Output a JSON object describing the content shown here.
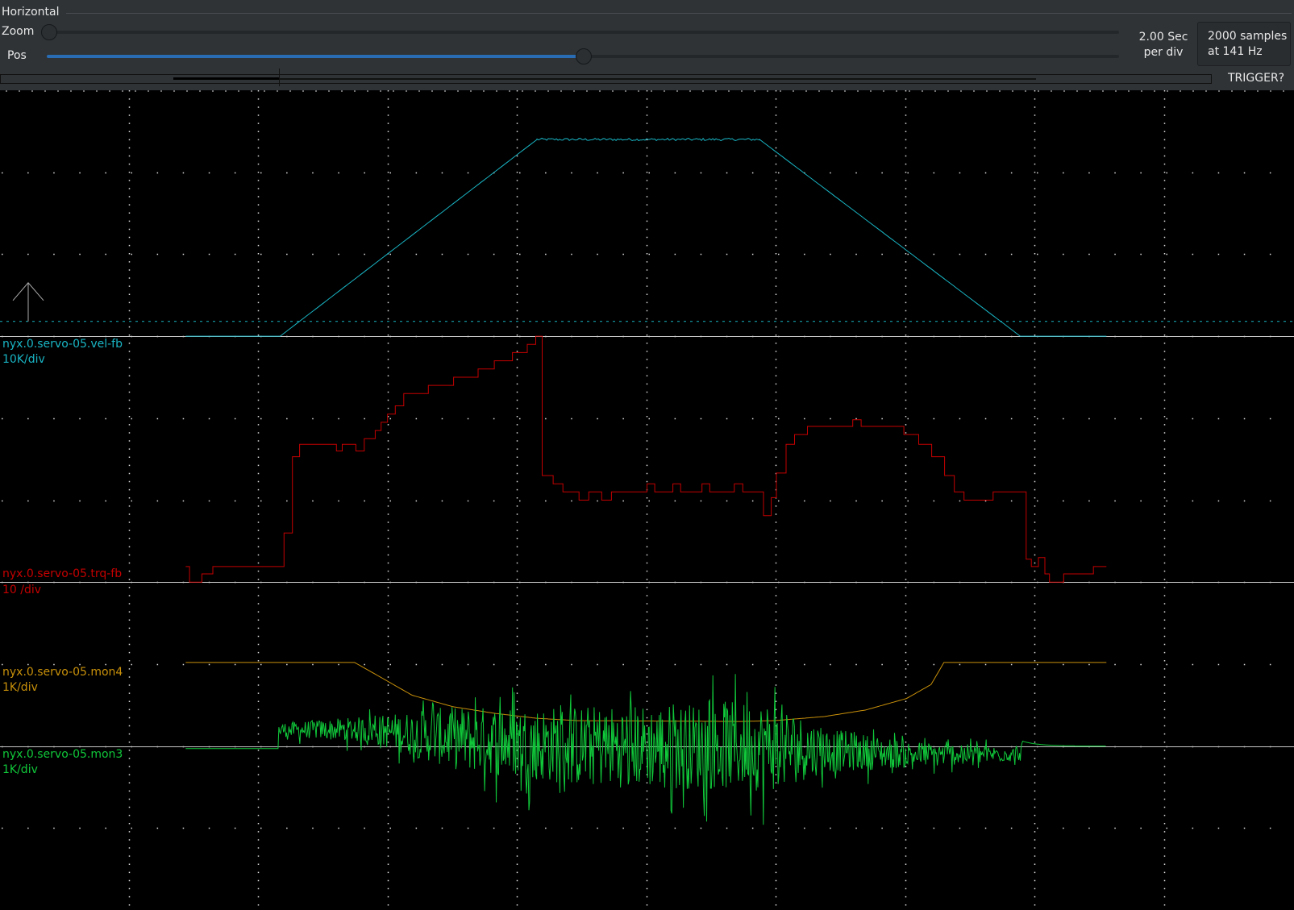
{
  "header": {
    "section_label": "Horizontal",
    "zoom_label": "Zoom",
    "pos_label": "Pos",
    "zoom_value": 0,
    "pos_value": 0.5,
    "timebase_line1": "2.00 Sec",
    "timebase_line2": "per div",
    "samples_line1": "2000 samples",
    "samples_line2": "at 141 Hz",
    "trigger_status": "TRIGGER?"
  },
  "chart_data": {
    "type": "line",
    "xlim": [
      0,
      20
    ],
    "x_units": "s",
    "divisions": {
      "x": 10,
      "y": 10
    },
    "grid": true,
    "trigger": {
      "channel": "nyx.0.servo-05.vel-fb",
      "level": 1800,
      "direction": "rising"
    },
    "series": [
      {
        "name": "nyx.0.servo-05.vel-fb",
        "scale_label": "10K/div",
        "per_div": 10000,
        "baseline_div": 3,
        "color": "#19b5c4",
        "step": false,
        "jitter": 150,
        "points": [
          [
            2.87,
            0
          ],
          [
            4.33,
            0
          ],
          [
            8.3,
            24000
          ],
          [
            11.74,
            24000
          ],
          [
            15.77,
            0
          ],
          [
            17.1,
            0
          ]
        ]
      },
      {
        "name": "nyx.0.servo-05.trq-fb",
        "scale_label": "10 /div",
        "per_div": 10,
        "baseline_div": 6,
        "color": "#c40000",
        "step": true,
        "points": [
          [
            2.87,
            1.9
          ],
          [
            2.93,
            0
          ],
          [
            3.12,
            1.0
          ],
          [
            3.29,
            1.9
          ],
          [
            4.39,
            6.0
          ],
          [
            4.52,
            15.3
          ],
          [
            4.63,
            16.8
          ],
          [
            5.2,
            16.0
          ],
          [
            5.29,
            16.8
          ],
          [
            5.5,
            16.0
          ],
          [
            5.63,
            17.5
          ],
          [
            5.8,
            18.5
          ],
          [
            5.89,
            19.5
          ],
          [
            5.99,
            20.5
          ],
          [
            6.11,
            21.5
          ],
          [
            6.24,
            23.0
          ],
          [
            6.62,
            24.0
          ],
          [
            7.01,
            25.0
          ],
          [
            7.39,
            26.0
          ],
          [
            7.64,
            27.0
          ],
          [
            7.92,
            28.0
          ],
          [
            8.15,
            29.0
          ],
          [
            8.28,
            30.0
          ],
          [
            8.38,
            13.0
          ],
          [
            8.55,
            12.0
          ],
          [
            8.7,
            11.0
          ],
          [
            8.95,
            10.0
          ],
          [
            9.1,
            11.0
          ],
          [
            9.3,
            10.0
          ],
          [
            9.45,
            11.0
          ],
          [
            10.0,
            12.0
          ],
          [
            10.12,
            11.0
          ],
          [
            10.4,
            12.0
          ],
          [
            10.52,
            11.0
          ],
          [
            10.85,
            12.0
          ],
          [
            10.97,
            11.0
          ],
          [
            11.35,
            12.0
          ],
          [
            11.48,
            11.0
          ],
          [
            11.8,
            8.1
          ],
          [
            11.92,
            10.3
          ],
          [
            12.0,
            13.3
          ],
          [
            12.15,
            16.8
          ],
          [
            12.28,
            18.0
          ],
          [
            12.48,
            19.0
          ],
          [
            13.18,
            19.8
          ],
          [
            13.31,
            19.0
          ],
          [
            13.97,
            18.0
          ],
          [
            14.2,
            16.8
          ],
          [
            14.4,
            15.3
          ],
          [
            14.6,
            13.0
          ],
          [
            14.75,
            11.0
          ],
          [
            14.9,
            10.0
          ],
          [
            15.35,
            11.0
          ],
          [
            15.86,
            2.8
          ],
          [
            15.94,
            1.9
          ],
          [
            16.05,
            3.0
          ],
          [
            16.15,
            1.0
          ],
          [
            16.22,
            0
          ],
          [
            16.44,
            1.0
          ],
          [
            16.9,
            1.9
          ],
          [
            17.1,
            1.9
          ]
        ]
      },
      {
        "name": "nyx.0.servo-05.mon4",
        "scale_label": "1K/div",
        "per_div": 1000,
        "baseline_div": 7,
        "color": "#c8900a",
        "step": false,
        "points": [
          [
            2.87,
            20
          ],
          [
            5.48,
            20
          ],
          [
            5.86,
            -150
          ],
          [
            6.37,
            -380
          ],
          [
            7.0,
            -520
          ],
          [
            7.64,
            -600
          ],
          [
            8.28,
            -660
          ],
          [
            8.92,
            -690
          ],
          [
            11.46,
            -700
          ],
          [
            11.97,
            -690
          ],
          [
            12.74,
            -640
          ],
          [
            13.38,
            -560
          ],
          [
            14.01,
            -420
          ],
          [
            14.39,
            -250
          ],
          [
            14.59,
            20
          ],
          [
            17.1,
            20
          ]
        ]
      },
      {
        "name": "nyx.0.servo-05.mon3",
        "scale_label": "1K/div",
        "per_div": 1000,
        "baseline_div": 8,
        "color": "#10c83a",
        "step": false,
        "envelope": [
          [
            2.87,
            -30,
            0
          ],
          [
            4.3,
            -30,
            0
          ],
          [
            4.31,
            200,
            150
          ],
          [
            5.73,
            200,
            300
          ],
          [
            7.0,
            100,
            700
          ],
          [
            8.92,
            0,
            900
          ],
          [
            11.97,
            0,
            1000
          ],
          [
            12.74,
            -50,
            500
          ],
          [
            14.01,
            -100,
            300
          ],
          [
            15.77,
            -100,
            150
          ],
          [
            15.8,
            50,
            0
          ],
          [
            16.6,
            0,
            0
          ],
          [
            17.1,
            0,
            0
          ]
        ]
      }
    ]
  }
}
